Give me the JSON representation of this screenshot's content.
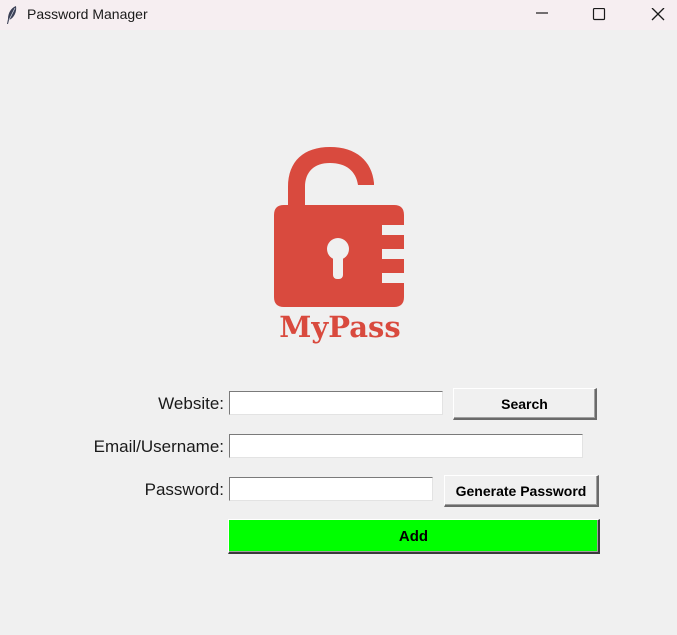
{
  "window": {
    "title": "Password Manager",
    "icon": "feather-icon"
  },
  "titlebar_controls": [
    "minimize-icon",
    "maximize-icon",
    "close-icon"
  ],
  "logo": {
    "icon": "open-padlock-icon",
    "text": "MyPass",
    "color": "#d94a3e"
  },
  "form": {
    "website_label": "Website:",
    "website_value": "",
    "email_label": "Email/Username:",
    "email_value": "",
    "password_label": "Password:",
    "password_value": "",
    "search_label": "Search",
    "generate_label": "Generate Password",
    "add_label": "Add",
    "add_color": "#00ff00"
  }
}
